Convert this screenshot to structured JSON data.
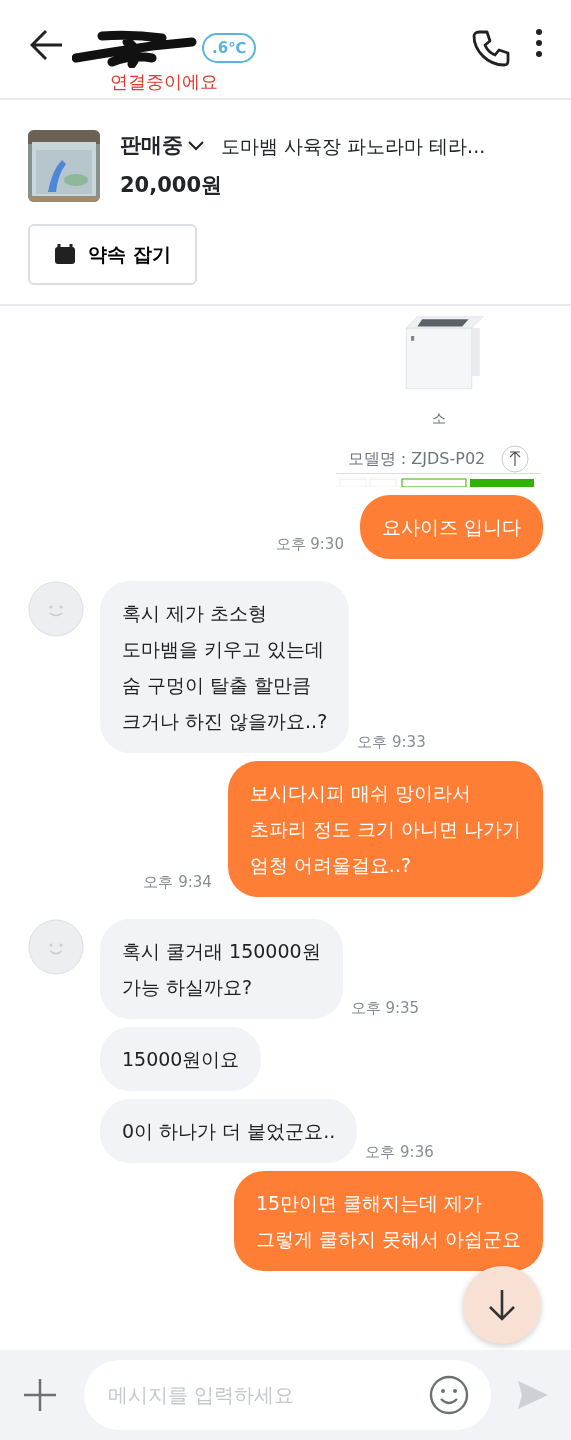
{
  "header": {
    "temperature": ".6℃",
    "status": "연결중이에요"
  },
  "product": {
    "status": "판매중",
    "title": "도마뱀 사육장 파노라마 테라...",
    "price": "20,000원",
    "button": "약속 잡기"
  },
  "messages": [
    {
      "caption": "소",
      "model": "모델명 : ZJDS-P02"
    },
    {
      "kind": "sent",
      "text": "요사이즈 입니다",
      "time": "오후 9:30"
    },
    {
      "kind": "received",
      "avatar": true,
      "text": "혹시 제가 초소형\n도마뱀을 키우고 있는데\n숨 구멍이 탈출 할만큼\n크거나 하진 않을까요..?",
      "time": "오후 9:33"
    },
    {
      "kind": "sent",
      "text": "보시다시피 매쉬 망이라서\n초파리 정도 크기 아니면 나가기\n엄청 어려울걸요..?",
      "time": "오후 9:34"
    },
    {
      "kind": "received",
      "avatar": true,
      "text": "혹시 쿨거래 150000원\n가능 하실까요?",
      "time": "오후 9:35"
    },
    {
      "kind": "received",
      "avatar": false,
      "text": "15000원이요"
    },
    {
      "kind": "received",
      "avatar": false,
      "text": "0이 하나가 더 붙었군요..",
      "time": "오후 9:36"
    },
    {
      "kind": "sent",
      "text": "15만이면 쿨해지는데 제가\n그렇게 쿨하지 못해서 아쉽군요"
    }
  ],
  "input": {
    "placeholder": "메시지를 입력하세요"
  }
}
